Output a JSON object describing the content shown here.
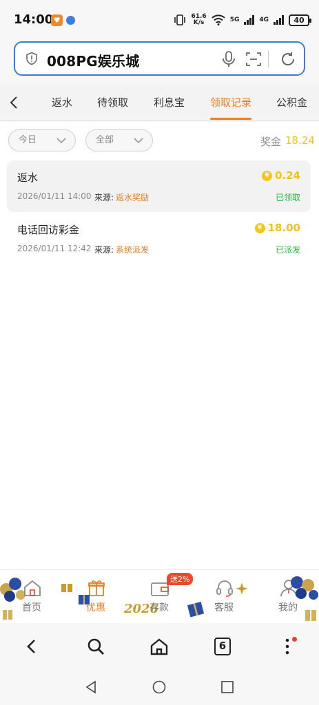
{
  "status_bar": {
    "time": "14:00",
    "net_speed_value": "61.6",
    "net_speed_unit": "K/s",
    "wifi_label": "5G",
    "cell_label": "4G",
    "battery": "40"
  },
  "url_bar": {
    "text": "008PG娱乐城"
  },
  "tabs": [
    {
      "label": "返水"
    },
    {
      "label": "待领取"
    },
    {
      "label": "利息宝"
    },
    {
      "label": "领取记录"
    },
    {
      "label": "公积金"
    }
  ],
  "filters": {
    "date": "今日",
    "type": "全部"
  },
  "bonus": {
    "label": "奖金",
    "value": "18.24"
  },
  "records": [
    {
      "title": "返水",
      "time": "2026/01/11 14:00",
      "source_label": "来源:",
      "source": "返水奖励",
      "amount": "0.24",
      "status": "已领取"
    },
    {
      "title": "电话回访彩金",
      "time": "2026/01/11 12:42",
      "source_label": "来源:",
      "source": "系统派发",
      "amount": "18.00",
      "status": "已派发"
    }
  ],
  "coin_symbol": "¥",
  "app_nav": [
    {
      "label": "首页",
      "icon": "home-icon"
    },
    {
      "label": "优惠",
      "icon": "gift-icon"
    },
    {
      "label": "存款",
      "icon": "wallet-icon"
    },
    {
      "label": "客服",
      "icon": "headset-icon"
    },
    {
      "label": "我的",
      "icon": "user-icon"
    }
  ],
  "deposit_badge": "送2%",
  "deco_year": "2026",
  "browser_bar": {
    "tab_count": "6"
  },
  "colors": {
    "accent": "#ee7d1f",
    "gold": "#f1c21b",
    "green": "#2fb545",
    "url_border": "#3a7be3"
  }
}
